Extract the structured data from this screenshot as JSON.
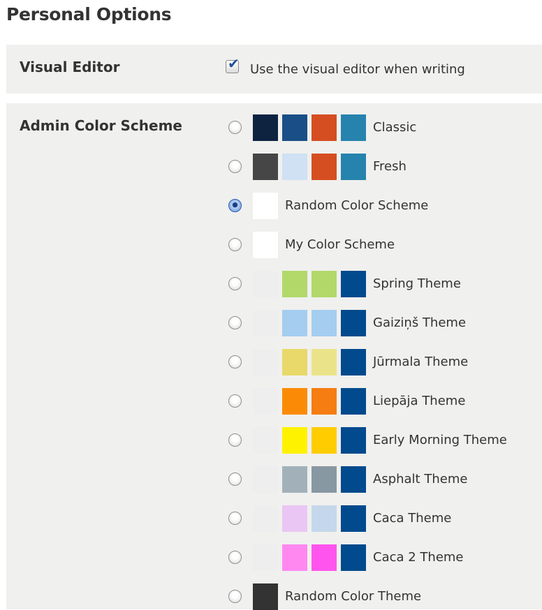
{
  "page": {
    "title": "Personal Options"
  },
  "visual_editor": {
    "label": "Visual Editor",
    "checkbox_label": "Use the visual editor when writing",
    "checked": true
  },
  "color_scheme": {
    "label": "Admin Color Scheme",
    "options": [
      {
        "name": "Classic",
        "selected": false,
        "colors": [
          "#0d2340",
          "#1a4e86",
          "#d54e21",
          "#2683ae"
        ]
      },
      {
        "name": "Fresh",
        "selected": false,
        "colors": [
          "#464646",
          "#cfe1f3",
          "#d54e21",
          "#2683ae"
        ]
      },
      {
        "name": "Random Color Scheme",
        "selected": true,
        "colors": [
          "#ffffff"
        ]
      },
      {
        "name": "My Color Scheme",
        "selected": false,
        "colors": [
          "#ffffff"
        ]
      },
      {
        "name": "Spring Theme",
        "selected": false,
        "colors": [
          "#eeeeee",
          "#b2d86a",
          "#b2d86a",
          "#004a8d"
        ]
      },
      {
        "name": "Gaiziņš Theme",
        "selected": false,
        "colors": [
          "#eeeeee",
          "#a4cdf0",
          "#a4cdf0",
          "#004a8d"
        ]
      },
      {
        "name": "Jūrmala Theme",
        "selected": false,
        "colors": [
          "#eeeeee",
          "#e8d96a",
          "#ebe38a",
          "#004a8d"
        ]
      },
      {
        "name": "Liepāja Theme",
        "selected": false,
        "colors": [
          "#eeeeee",
          "#fb8b07",
          "#f57d12",
          "#004a8d"
        ]
      },
      {
        "name": "Early Morning Theme",
        "selected": false,
        "colors": [
          "#eeeeee",
          "#fff200",
          "#ffcc00",
          "#004a8d"
        ]
      },
      {
        "name": "Asphalt Theme",
        "selected": false,
        "colors": [
          "#eeeeee",
          "#a2b1b9",
          "#8798a2",
          "#004a8d"
        ]
      },
      {
        "name": "Caca Theme",
        "selected": false,
        "colors": [
          "#eeeeee",
          "#eac6f5",
          "#c5d8eb",
          "#004a8d"
        ]
      },
      {
        "name": "Caca 2 Theme",
        "selected": false,
        "colors": [
          "#eeeeee",
          "#ff88f0",
          "#ff55ee",
          "#004a8d"
        ]
      },
      {
        "name": "Random Color Theme",
        "selected": false,
        "colors": [
          "#333333"
        ]
      }
    ]
  }
}
